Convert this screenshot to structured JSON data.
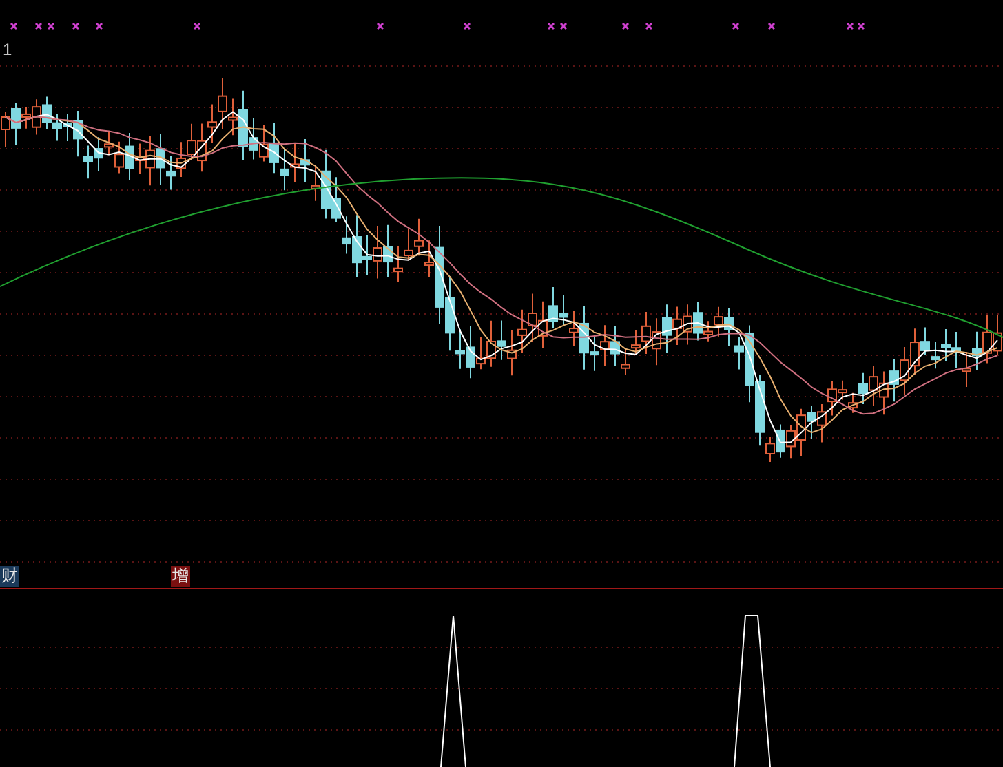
{
  "price_panel": {
    "corner_label": "1"
  },
  "indicator_panel": {
    "labels": [
      {
        "text": "财",
        "color": "#1b3a5a"
      },
      {
        "text": "增",
        "color": "#7a1010"
      }
    ]
  }
}
